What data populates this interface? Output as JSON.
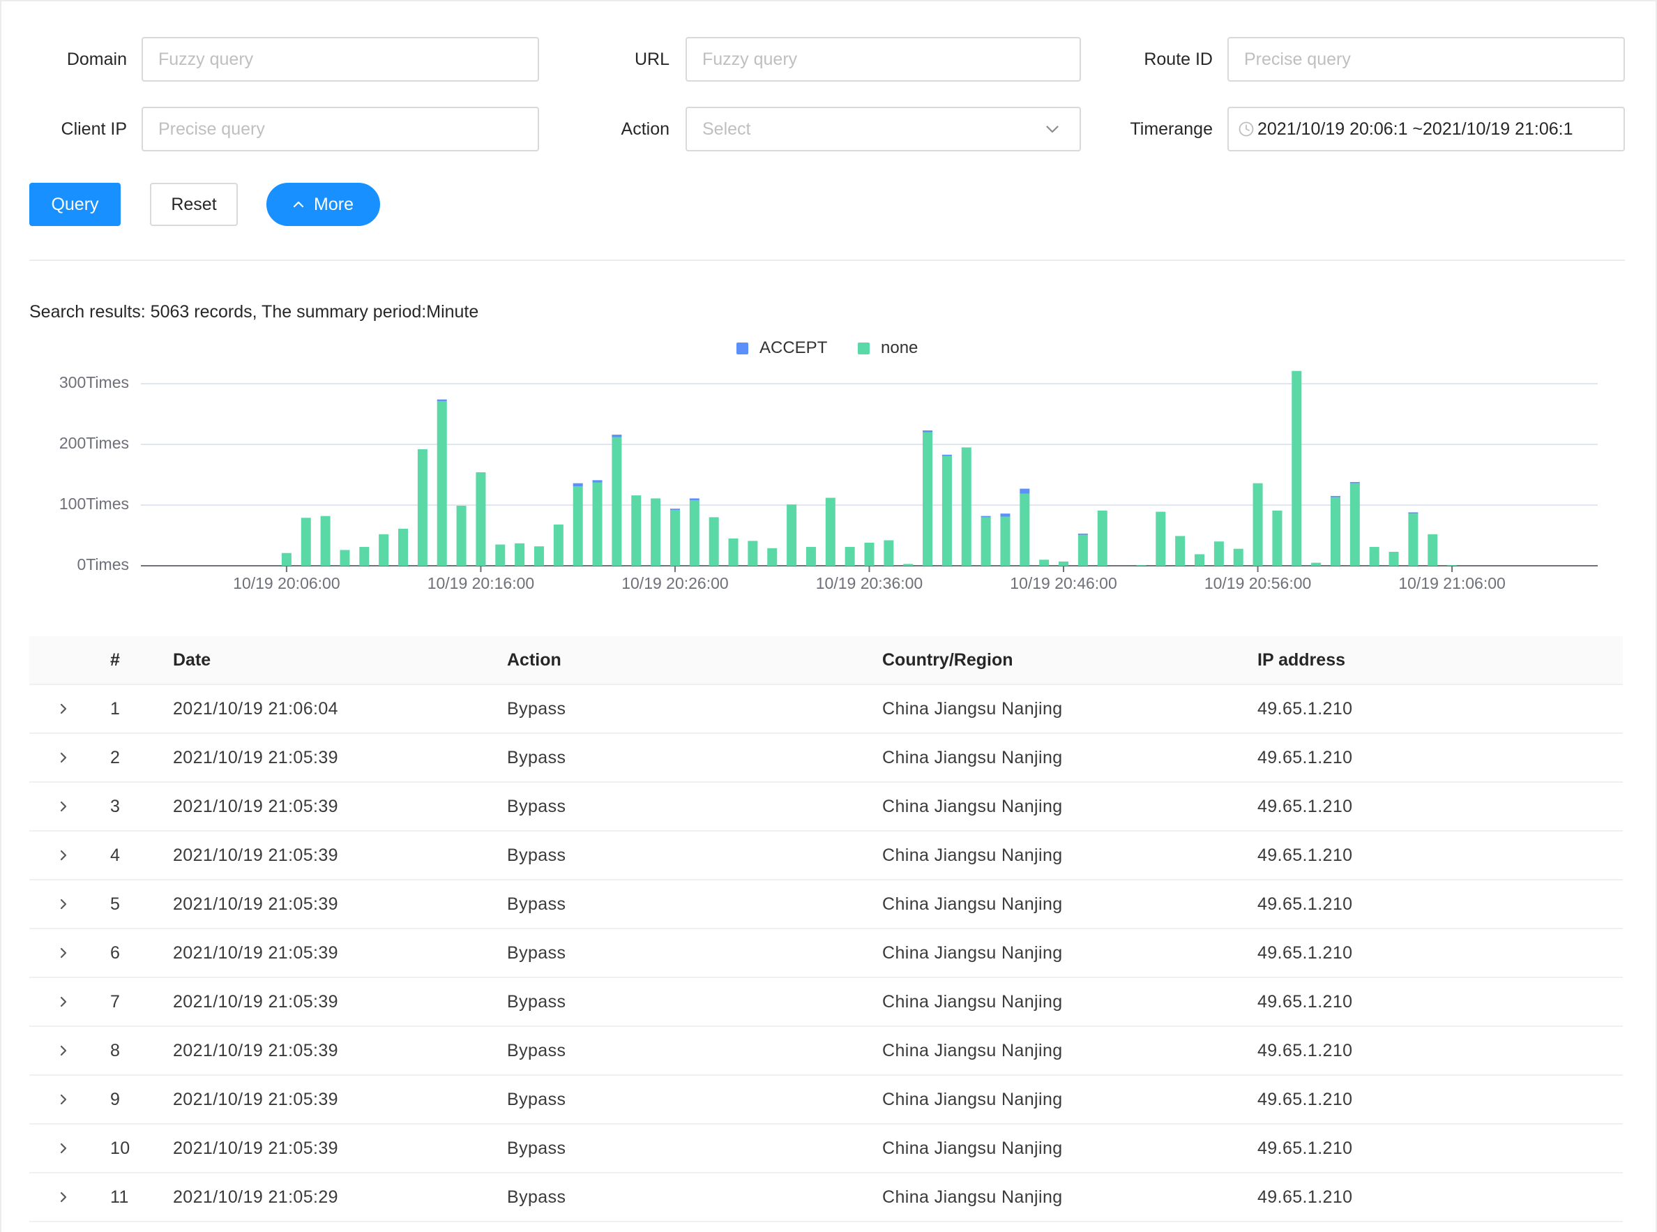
{
  "colors": {
    "primary": "#1890ff"
  },
  "icons": {
    "action_dropdown": "chevron-down-icon",
    "timerange": "clock-icon",
    "more_button": "chevron-up-icon",
    "row_expand": "chevron-right-icon"
  },
  "filters": {
    "domain": {
      "label": "Domain",
      "placeholder": "Fuzzy query"
    },
    "url": {
      "label": "URL",
      "placeholder": "Fuzzy query"
    },
    "route_id": {
      "label": "Route ID",
      "placeholder": "Precise query"
    },
    "client_ip": {
      "label": "Client IP",
      "placeholder": "Precise query"
    },
    "action": {
      "label": "Action",
      "placeholder": "Select"
    },
    "timerange": {
      "label": "Timerange",
      "value": "2021/10/19 20:06:1 ~2021/10/19 21:06:1"
    }
  },
  "buttons": {
    "query": "Query",
    "reset": "Reset",
    "more": "More"
  },
  "summary": "Search results: 5063 records, The summary period:Minute",
  "chart_data": {
    "type": "bar",
    "stacked": true,
    "grid": true,
    "legend_position": "top-center",
    "xlim": [
      "10/19 19:58:30",
      "10/19 21:13:30"
    ],
    "ylim": [
      0,
      300
    ],
    "y_ticks": [
      0,
      100,
      200,
      300
    ],
    "y_tick_labels": [
      "0Times",
      "100Times",
      "200Times",
      "300Times"
    ],
    "x_ticks": [
      "10/19 20:06:00",
      "10/19 20:16:00",
      "10/19 20:26:00",
      "10/19 20:36:00",
      "10/19 20:46:00",
      "10/19 20:56:00",
      "10/19 21:06:00"
    ],
    "x": [
      "10/19 20:06:00",
      "10/19 20:07:00",
      "10/19 20:08:00",
      "10/19 20:09:00",
      "10/19 20:10:00",
      "10/19 20:11:00",
      "10/19 20:12:00",
      "10/19 20:13:00",
      "10/19 20:14:00",
      "10/19 20:15:00",
      "10/19 20:16:00",
      "10/19 20:17:00",
      "10/19 20:18:00",
      "10/19 20:19:00",
      "10/19 20:20:00",
      "10/19 20:21:00",
      "10/19 20:22:00",
      "10/19 20:23:00",
      "10/19 20:24:00",
      "10/19 20:25:00",
      "10/19 20:26:00",
      "10/19 20:27:00",
      "10/19 20:28:00",
      "10/19 20:29:00",
      "10/19 20:30:00",
      "10/19 20:31:00",
      "10/19 20:32:00",
      "10/19 20:33:00",
      "10/19 20:34:00",
      "10/19 20:35:00",
      "10/19 20:36:00",
      "10/19 20:37:00",
      "10/19 20:38:00",
      "10/19 20:39:00",
      "10/19 20:40:00",
      "10/19 20:41:00",
      "10/19 20:42:00",
      "10/19 20:43:00",
      "10/19 20:44:00",
      "10/19 20:45:00",
      "10/19 20:46:00",
      "10/19 20:47:00",
      "10/19 20:48:00",
      "10/19 20:49:00",
      "10/19 20:50:00",
      "10/19 20:51:00",
      "10/19 20:52:00",
      "10/19 20:53:00",
      "10/19 20:54:00",
      "10/19 20:55:00",
      "10/19 20:56:00",
      "10/19 20:57:00",
      "10/19 20:58:00",
      "10/19 20:59:00",
      "10/19 21:00:00",
      "10/19 21:01:00",
      "10/19 21:02:00",
      "10/19 21:03:00",
      "10/19 21:04:00",
      "10/19 21:05:00",
      "10/19 21:06:00"
    ],
    "series": [
      {
        "name": "ACCEPT",
        "color": "#5B8FF9",
        "values": [
          0,
          0,
          0,
          0,
          0,
          0,
          0,
          0,
          3,
          0,
          0,
          0,
          0,
          0,
          0,
          5,
          4,
          4,
          0,
          0,
          2,
          3,
          0,
          0,
          0,
          0,
          0,
          0,
          0,
          0,
          0,
          0,
          0,
          3,
          2,
          0,
          2,
          5,
          8,
          0,
          0,
          2,
          0,
          0,
          0,
          0,
          0,
          0,
          0,
          0,
          0,
          0,
          0,
          0,
          2,
          2,
          0,
          0,
          2,
          0,
          0
        ]
      },
      {
        "name": "none",
        "color": "#5AD8A6",
        "values": [
          21,
          79,
          82,
          26,
          31,
          52,
          61,
          192,
          271,
          99,
          154,
          35,
          37,
          32,
          68,
          131,
          137,
          212,
          116,
          111,
          92,
          108,
          80,
          45,
          41,
          29,
          101,
          31,
          112,
          31,
          38,
          42,
          3,
          220,
          181,
          195,
          80,
          81,
          119,
          10,
          7,
          51,
          91,
          0,
          1,
          89,
          49,
          19,
          40,
          28,
          136,
          91,
          321,
          5,
          113,
          136,
          31,
          23,
          86,
          52,
          1
        ]
      }
    ]
  },
  "table": {
    "columns": [
      "#",
      "Date",
      "Action",
      "Country/Region",
      "IP address"
    ],
    "rows": [
      {
        "index": "1",
        "date": "2021/10/19 21:06:04",
        "action": "Bypass",
        "region": "China Jiangsu Nanjing",
        "ip": "49.65.1.210"
      },
      {
        "index": "2",
        "date": "2021/10/19 21:05:39",
        "action": "Bypass",
        "region": "China Jiangsu Nanjing",
        "ip": "49.65.1.210"
      },
      {
        "index": "3",
        "date": "2021/10/19 21:05:39",
        "action": "Bypass",
        "region": "China Jiangsu Nanjing",
        "ip": "49.65.1.210"
      },
      {
        "index": "4",
        "date": "2021/10/19 21:05:39",
        "action": "Bypass",
        "region": "China Jiangsu Nanjing",
        "ip": "49.65.1.210"
      },
      {
        "index": "5",
        "date": "2021/10/19 21:05:39",
        "action": "Bypass",
        "region": "China Jiangsu Nanjing",
        "ip": "49.65.1.210"
      },
      {
        "index": "6",
        "date": "2021/10/19 21:05:39",
        "action": "Bypass",
        "region": "China Jiangsu Nanjing",
        "ip": "49.65.1.210"
      },
      {
        "index": "7",
        "date": "2021/10/19 21:05:39",
        "action": "Bypass",
        "region": "China Jiangsu Nanjing",
        "ip": "49.65.1.210"
      },
      {
        "index": "8",
        "date": "2021/10/19 21:05:39",
        "action": "Bypass",
        "region": "China Jiangsu Nanjing",
        "ip": "49.65.1.210"
      },
      {
        "index": "9",
        "date": "2021/10/19 21:05:39",
        "action": "Bypass",
        "region": "China Jiangsu Nanjing",
        "ip": "49.65.1.210"
      },
      {
        "index": "10",
        "date": "2021/10/19 21:05:39",
        "action": "Bypass",
        "region": "China Jiangsu Nanjing",
        "ip": "49.65.1.210"
      },
      {
        "index": "11",
        "date": "2021/10/19 21:05:29",
        "action": "Bypass",
        "region": "China Jiangsu Nanjing",
        "ip": "49.65.1.210"
      }
    ]
  }
}
